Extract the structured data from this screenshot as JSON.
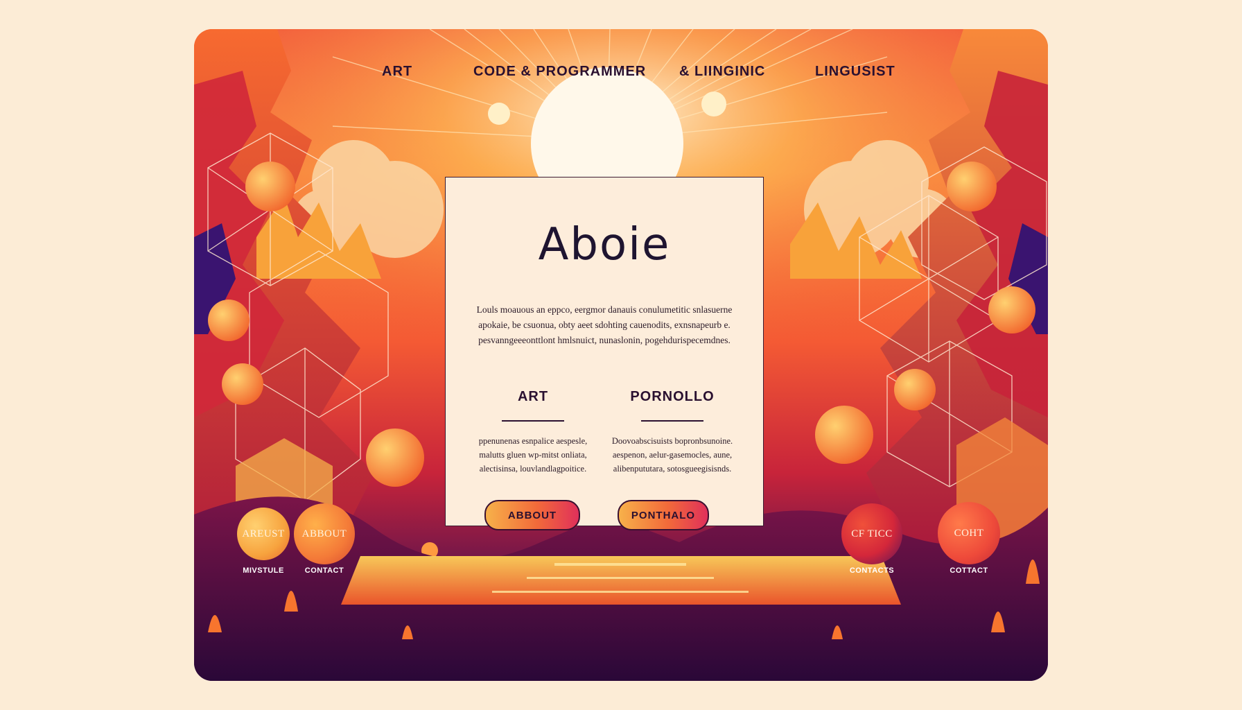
{
  "nav": {
    "items": [
      {
        "label": "ART"
      },
      {
        "label": "CODE & PROGRAMMER"
      },
      {
        "label": "& LIINGINIC"
      },
      {
        "label": "LINGUSIST"
      }
    ]
  },
  "card": {
    "title": "Aboie",
    "intro": "Louls moauous an eppco, eergmor danauis conulumetitic snlasuerne apokaie, be csuonua, obty aeet sdohting cauenodits, exnsnapeurb e. pesvanngeeeonttlont hmlsnuict, nunaslonin, pogehdurispecemdnes.",
    "columns": [
      {
        "heading": "ART",
        "text": "ppenunenas esnpalice aespesle, malutts gluen wp-mitst onliata, alectisinsa, louvlandlagpoitice."
      },
      {
        "heading": "PORNOLLO",
        "text": "Doovoabscisuists bopronbsunoine. aespenon, aelur-gasemocles, aune, alibenpututara, sotosgueegisisnds."
      }
    ],
    "buttons": {
      "about": "ABBOUT",
      "portfolio": "PONTHALO"
    }
  },
  "footer": {
    "circles": [
      {
        "label": "AREUST",
        "caption": "MIVSTULE",
        "color": "#f7a33e"
      },
      {
        "label": "ABBOUT",
        "caption": "CONTACT",
        "color": "#f47a38"
      },
      {
        "label": "CF TICC",
        "caption": "CONTACTS",
        "color": "#d4273a"
      },
      {
        "label": "COHT",
        "caption": "COTTACT",
        "color": "#ee4a3a"
      }
    ]
  },
  "colors": {
    "background": "#fcecd6",
    "card": "#fdeddb",
    "ink": "#2a1030",
    "accent_orange": "#f7a33e",
    "accent_red": "#e0305a"
  }
}
